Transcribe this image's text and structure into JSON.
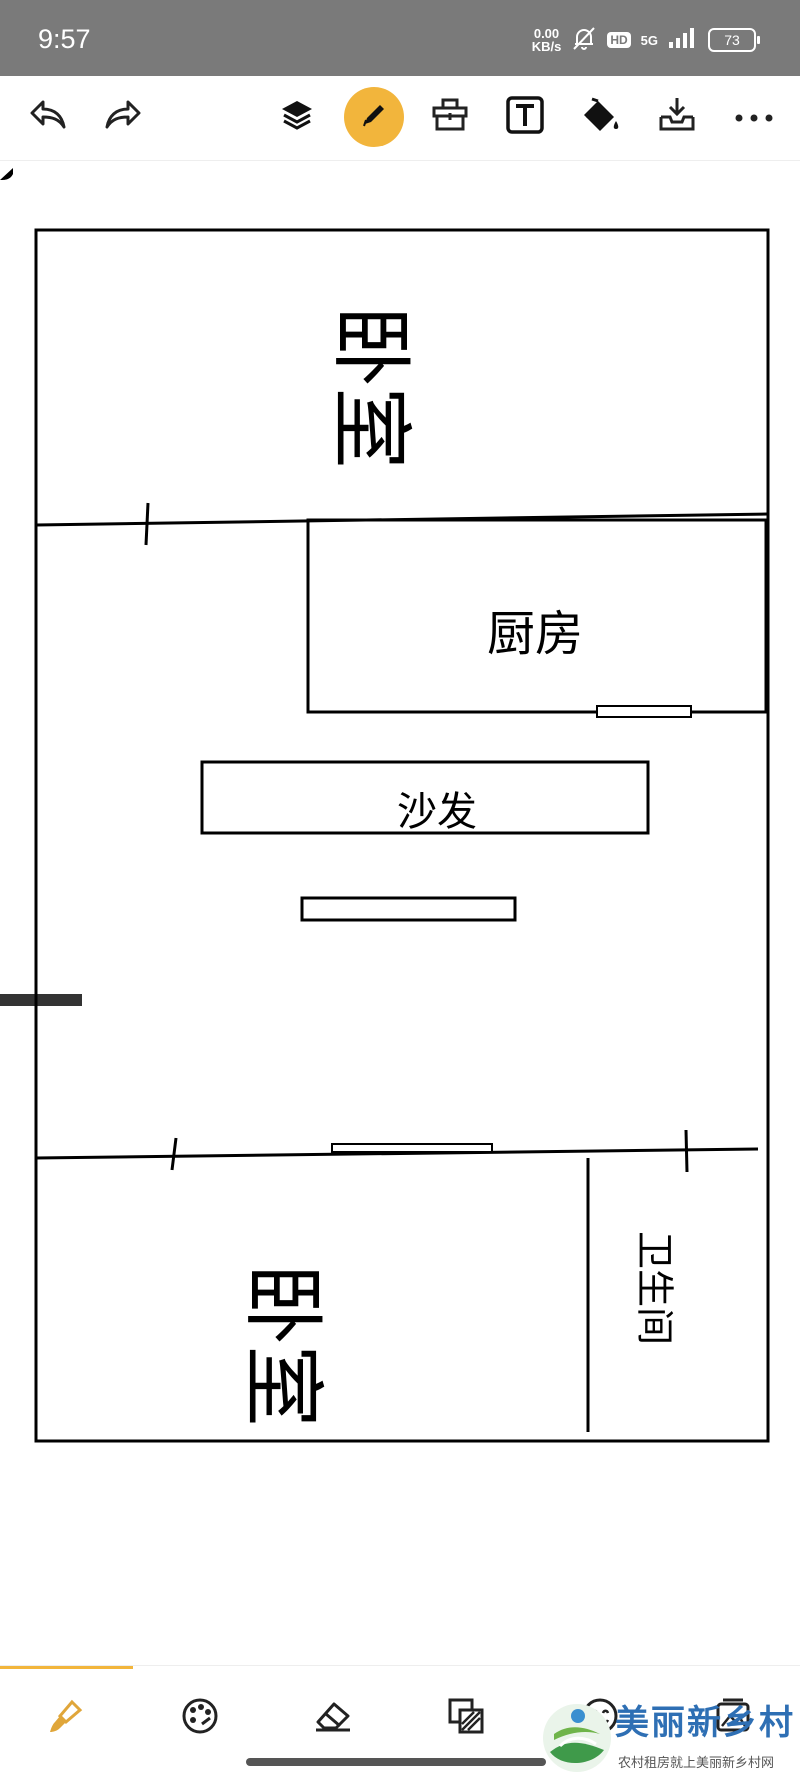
{
  "status_bar": {
    "time": "9:57",
    "net_speed_value": "0.00",
    "net_speed_unit": "KB/s",
    "hd_badge": "HD",
    "network_type": "5G",
    "battery_level": "73",
    "icons": [
      "mute-bell-icon",
      "signal-bars-icon",
      "battery-icon"
    ]
  },
  "toolbar": {
    "active_tool": "pencil",
    "active_color": "#f2b53c",
    "icons": [
      "undo-icon",
      "redo-icon",
      "layers-icon",
      "pencil-icon",
      "toolbox-icon",
      "text-tool-icon",
      "fill-bucket-icon",
      "import-icon",
      "more-icon"
    ]
  },
  "floor_plan": {
    "rooms": {
      "bedroom_top": "卧室",
      "kitchen": "厨房",
      "sofa": "沙发",
      "bedroom_bottom": "卧室",
      "bathroom": "卫生间"
    }
  },
  "bottom_toolbar": {
    "active_tool": "brush",
    "icons": [
      "brush-icon",
      "palette-icon",
      "eraser-icon",
      "pattern-fill-icon",
      "emoji-icon",
      "image-icon"
    ]
  },
  "watermark": {
    "title": "美丽新乡村",
    "subtitle": "农村租房就上美丽新乡村网"
  }
}
